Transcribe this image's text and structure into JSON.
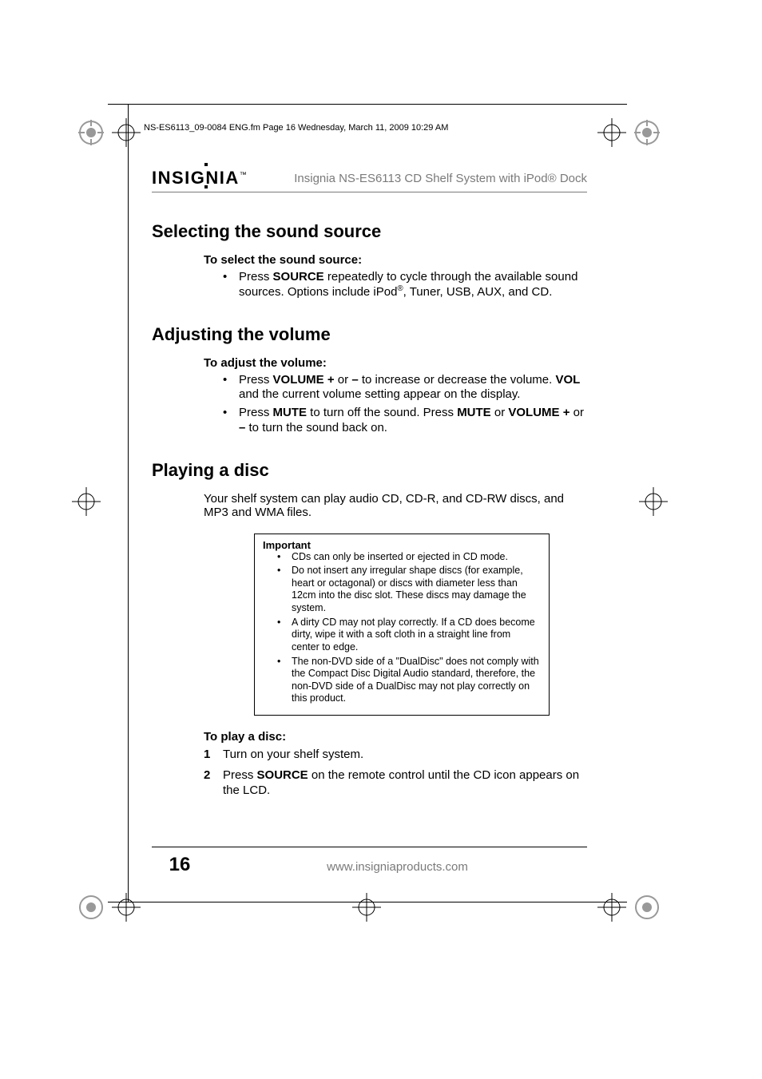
{
  "frame_header": "NS-ES6113_09-0084 ENG.fm  Page 16  Wednesday, March 11, 2009  10:29 AM",
  "logo_text": "INSIGNIA",
  "logo_tm": "™",
  "doc_subtitle": "Insignia NS-ES6113 CD Shelf System with iPod® Dock",
  "sections": {
    "sound_source": {
      "heading": "Selecting the sound source",
      "subheading": "To select the sound source:",
      "bullets": [
        {
          "pre": "Press ",
          "b1": "SOURCE",
          "post": " repeatedly to cycle through the available sound sources. Options include iPod",
          "sup": "®",
          "tail": ", Tuner, USB, AUX, and CD."
        }
      ]
    },
    "volume": {
      "heading": "Adjusting the volume",
      "subheading": "To adjust the volume:",
      "bullets": [
        {
          "html_parts": [
            "Press ",
            "<b>VOLUME +</b>",
            " or ",
            "<b>–</b>",
            " to increase or decrease the volume. ",
            "<b>VOL</b>",
            " and the current volume setting appear on the display."
          ]
        },
        {
          "html_parts": [
            "Press ",
            "<b>MUTE</b>",
            " to turn off the sound. Press ",
            "<b>MUTE</b>",
            " or ",
            "<b>VOLUME +</b>",
            " or ",
            "<b>–</b>",
            " to turn the sound back on."
          ]
        }
      ]
    },
    "disc": {
      "heading": "Playing a disc",
      "intro": "Your shelf system can play audio CD, CD-R, and CD-RW discs, and MP3 and WMA files.",
      "important_label": "Important",
      "important_items": [
        "CDs can only be inserted or ejected in CD mode.",
        "Do not insert any irregular shape discs (for example, heart or octagonal) or discs with diameter less than 12cm into the disc slot. These discs may damage the system.",
        "A dirty CD may not play correctly. If a CD does become dirty, wipe it with a soft cloth in a straight line from center to edge.",
        "The non-DVD side of a \"DualDisc\" does not comply with the Compact Disc Digital Audio standard, therefore, the non-DVD side of a DualDisc may not play correctly on this product."
      ],
      "play_subheading": "To play a disc:",
      "steps": [
        {
          "n": "1",
          "text": "Turn on your shelf system."
        },
        {
          "n": "2",
          "pre": "Press ",
          "b1": "SOURCE",
          "post": " on the remote control until the CD icon appears on the LCD."
        }
      ]
    }
  },
  "footer": {
    "page": "16",
    "url": "www.insigniaproducts.com"
  }
}
